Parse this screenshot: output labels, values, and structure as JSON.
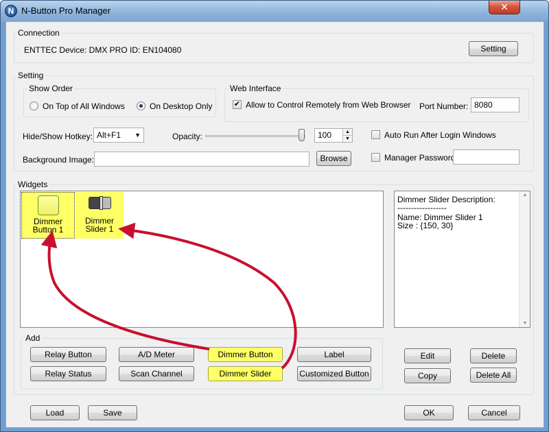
{
  "window": {
    "title": "N-Button Pro Manager",
    "app_icon_letter": "N",
    "close_label": "✕"
  },
  "connection": {
    "group_label": "Connection",
    "device_text": "ENTTEC Device: DMX PRO ID: EN104080",
    "setting_button": "Setting"
  },
  "setting": {
    "group_label": "Setting",
    "show_order": {
      "label": "Show Order",
      "option_top": "On Top of All Windows",
      "option_desktop": "On Desktop Only",
      "selected": "On Desktop Only"
    },
    "web_interface": {
      "label": "Web Interface",
      "allow_remote_label": "Allow to Control Remotely from Web Browser",
      "allow_remote_checked": true,
      "port_label": "Port Number:",
      "port_value": "8080"
    },
    "hotkey_label": "Hide/Show Hotkey:",
    "hotkey_value": "Alt+F1",
    "opacity_label": "Opacity:",
    "opacity_value": "100",
    "autorun_label": "Auto Run After Login Windows",
    "background_label": "Background Image:",
    "background_value": "",
    "browse_button": "Browse",
    "password_label": "Manager Password",
    "password_value": ""
  },
  "widgets": {
    "group_label": "Widgets",
    "items": [
      {
        "label_line1": "Dimmer",
        "label_line2": "Button 1"
      },
      {
        "label_line1": "Dimmer",
        "label_line2": "Slider 1"
      }
    ],
    "description": {
      "title": "Dimmer Slider Description:",
      "separator": "------------------",
      "name_line": "Name: Dimmer Slider 1",
      "size_line": "Size : {150, 30}"
    }
  },
  "add": {
    "group_label": "Add",
    "relay_button": "Relay Button",
    "ad_meter": "A/D Meter",
    "dimmer_button": "Dimmer Button",
    "label": "Label",
    "relay_status": "Relay Status",
    "scan_channel": "Scan Channel",
    "dimmer_slider": "Dimmer Slider",
    "customized_button": "Customized Button"
  },
  "actions": {
    "edit": "Edit",
    "delete": "Delete",
    "copy": "Copy",
    "delete_all": "Delete All"
  },
  "footer": {
    "load": "Load",
    "save": "Save",
    "ok": "OK",
    "cancel": "Cancel"
  },
  "colors": {
    "highlight": "#ffff66",
    "arrow": "#c8102e"
  }
}
